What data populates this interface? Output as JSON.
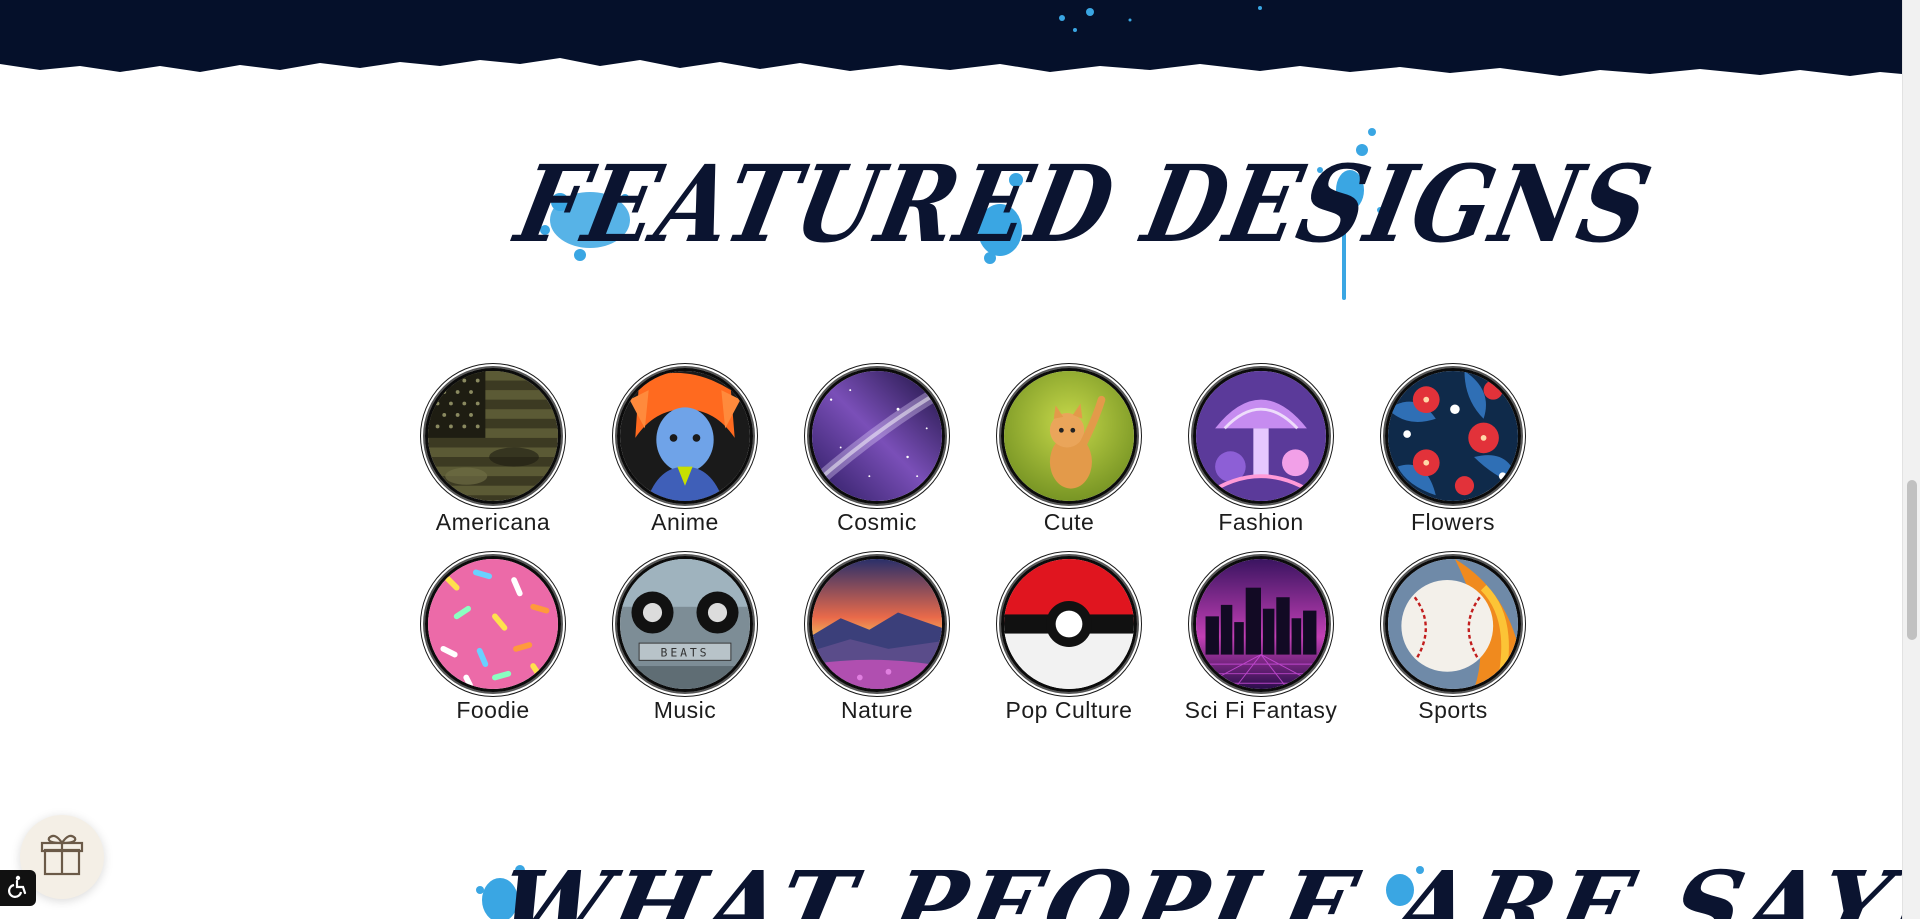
{
  "section": {
    "heading": "FEATURED DESIGNS",
    "next_heading": "WHAT PEOPLE ARE SAYING"
  },
  "categories": [
    {
      "label": "Americana",
      "icon": "americana-thumb"
    },
    {
      "label": "Anime",
      "icon": "anime-thumb"
    },
    {
      "label": "Cosmic",
      "icon": "cosmic-thumb"
    },
    {
      "label": "Cute",
      "icon": "cute-thumb"
    },
    {
      "label": "Fashion",
      "icon": "fashion-thumb"
    },
    {
      "label": "Flowers",
      "icon": "flowers-thumb"
    },
    {
      "label": "Foodie",
      "icon": "foodie-thumb"
    },
    {
      "label": "Music",
      "icon": "music-thumb"
    },
    {
      "label": "Nature",
      "icon": "nature-thumb"
    },
    {
      "label": "Pop Culture",
      "icon": "pop-culture-thumb"
    },
    {
      "label": "Sci Fi Fantasy",
      "icon": "sci-fi-fantasy-thumb"
    },
    {
      "label": "Sports",
      "icon": "sports-thumb"
    }
  ],
  "music_thumb_text": "BEATS",
  "floating": {
    "gift_icon": "gift-icon",
    "accessibility_icon": "wheelchair-icon"
  },
  "colors": {
    "navy": "#0b1430",
    "splash_blue": "#3aa6e3",
    "background": "#ffffff"
  }
}
